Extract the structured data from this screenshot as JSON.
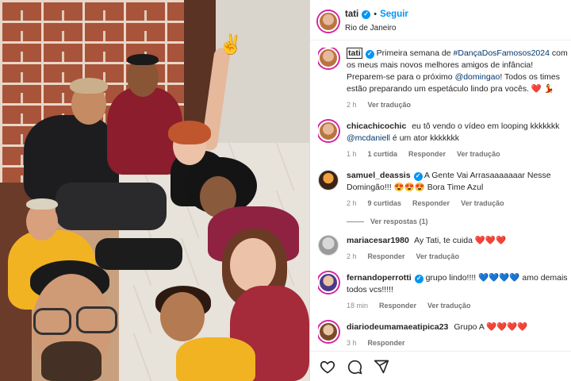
{
  "post": {
    "author": "tati",
    "follow_label": "Seguir",
    "location": "Rio de Janeiro"
  },
  "caption": {
    "user": "tati",
    "text_before": "Primeira semana de ",
    "hashtag": "#DançaDosFamosos2024",
    "text_mid": " com os meus mais novos melhores amigos de infância! Preparem-se para o próximo ",
    "mention": "@domingao",
    "text_after": "! Todos os times estão preparando um espetáculo lindo pra vocês.",
    "emojis": "❤️ 💃",
    "time": "2 h",
    "translate": "Ver tradução"
  },
  "comments": [
    {
      "user": "chicachicochic",
      "text_before": "eu tô vendo o vídeo em looping kkkkkkk ",
      "mention": "@mcdaniell",
      "text_after": " é um ator kkkkkkk",
      "time": "1 h",
      "likes": "1 curtida",
      "reply": "Responder",
      "translate": "Ver tradução"
    },
    {
      "user": "samuel_deassis",
      "text": "A Gente Vai Arrasaaaaaaar Nesse Domingão!!!",
      "emojis": "😍😍😍",
      "text2": " Bora Time Azul",
      "time": "2 h",
      "likes": "9 curtidas",
      "reply": "Responder",
      "translate": "Ver tradução",
      "replies_label": "Ver respostas (1)"
    },
    {
      "user": "mariacesar1980",
      "text": "Ay Tati, te cuida",
      "emojis": "❤️❤️❤️",
      "time": "2 h",
      "reply": "Responder",
      "translate": "Ver tradução"
    },
    {
      "user": "fernandoperrotti",
      "text": "grupo lindo!!!!",
      "emojis": "💙💙💙💙",
      "text2": " amo demais todos vcs!!!!!",
      "time": "18 min",
      "reply": "Responder",
      "translate": "Ver tradução"
    },
    {
      "user": "diariodeumamaeatipica23",
      "text": "Grupo A",
      "emojis": "❤️❤️❤️❤️",
      "time": "3 h",
      "reply": "Responder"
    }
  ],
  "icons": [
    "heart-icon",
    "comment-icon",
    "share-icon",
    "verified-icon",
    "peace-sign-icon"
  ],
  "colors": {
    "accent": "#0095f6",
    "link": "#00376b",
    "heart": "#ed4956"
  }
}
